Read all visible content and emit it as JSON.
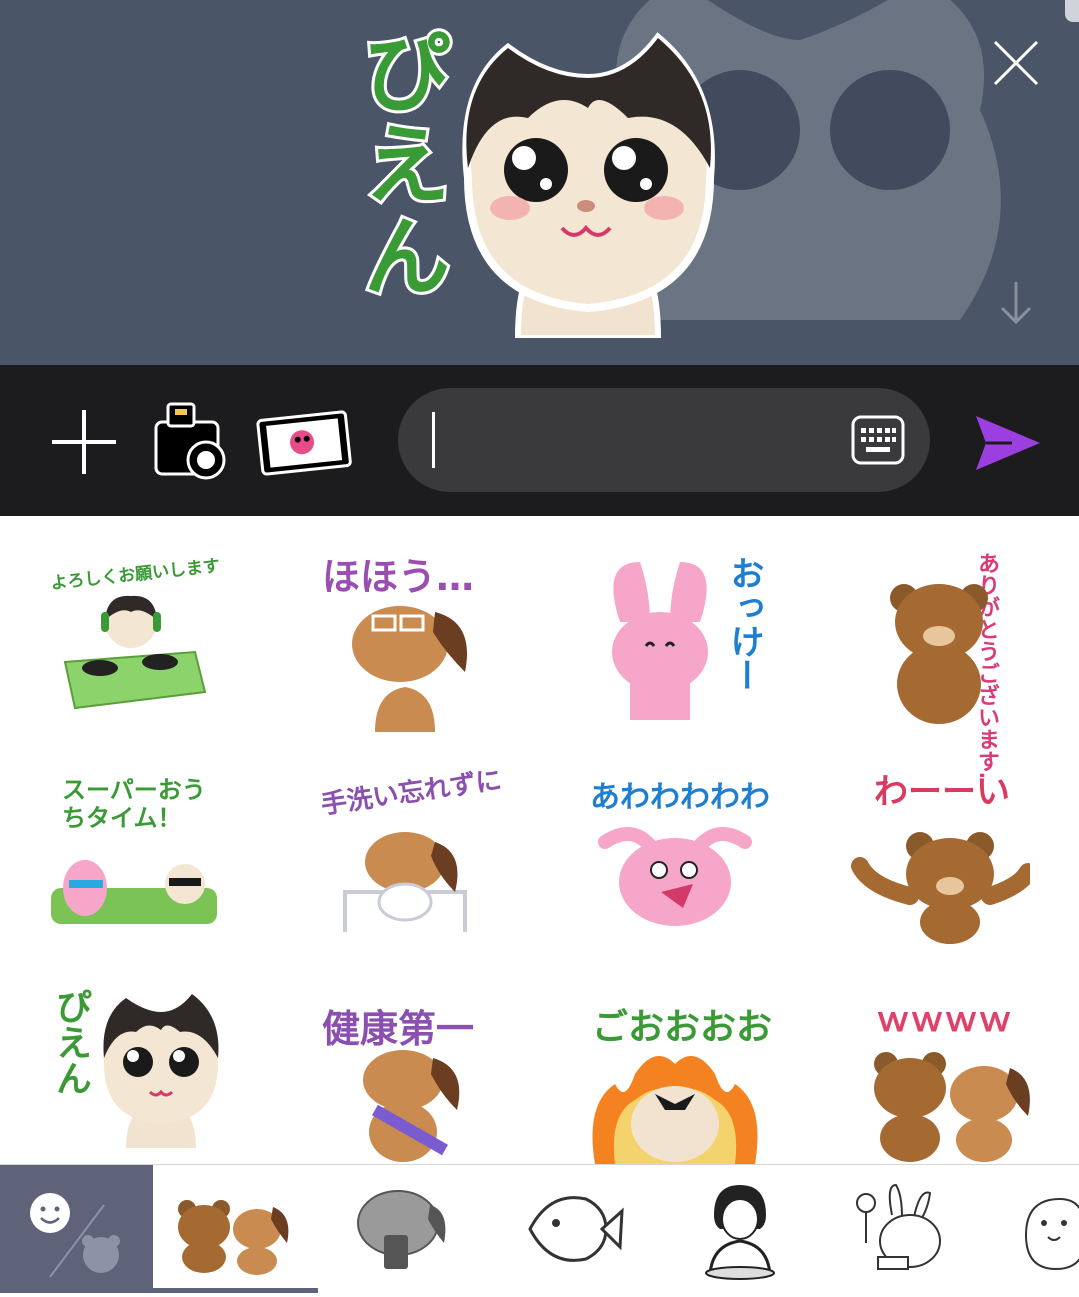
{
  "preview": {
    "sticker_text": "ぴえん",
    "close_icon": "close-icon",
    "scroll_down_icon": "arrow-down-icon"
  },
  "input_bar": {
    "plus_icon": "plus-icon",
    "camera_icon": "camera-icon",
    "album_icon": "photo-album-icon",
    "message_value": "",
    "keyboard_icon": "keyboard-icon",
    "send_icon": "send-icon",
    "send_color": "#9b3fe0"
  },
  "stickers": [
    {
      "text": "よろしくお願いします",
      "color": "#3a9a35"
    },
    {
      "text": "ほほう…",
      "color": "#9a4fb0"
    },
    {
      "text": "おっけー",
      "color": "#1e7fd1"
    },
    {
      "text": "ありがとうございます…",
      "color": "#d93a78"
    },
    {
      "text": "スーパーおうちタイム！",
      "color": "#3a9a35"
    },
    {
      "text": "手洗い忘れずに",
      "color": "#8a4fb0"
    },
    {
      "text": "あわわわわわ",
      "color": "#1e7fd1"
    },
    {
      "text": "わーーい",
      "color": "#d93a60"
    },
    {
      "text": "ぴえん",
      "color": "#3a9a35"
    },
    {
      "text": "健康第一",
      "color": "#8a4fb0"
    },
    {
      "text": "ごおおおお",
      "color": "#3a9a35"
    },
    {
      "text": "ｗｗｗｗ",
      "color": "#e0406a"
    }
  ],
  "tabbar": {
    "tabs": [
      {
        "icon": "emoji-tab-icon"
      },
      {
        "icon": "bear-dog-sticker-pack-icon"
      },
      {
        "icon": "dog-sticker-pack-icon"
      },
      {
        "icon": "fish-sticker-pack-icon"
      },
      {
        "icon": "person-sticker-pack-icon"
      },
      {
        "icon": "rabbit-sticker-pack-icon"
      },
      {
        "icon": "seal-sticker-pack-icon"
      }
    ]
  }
}
